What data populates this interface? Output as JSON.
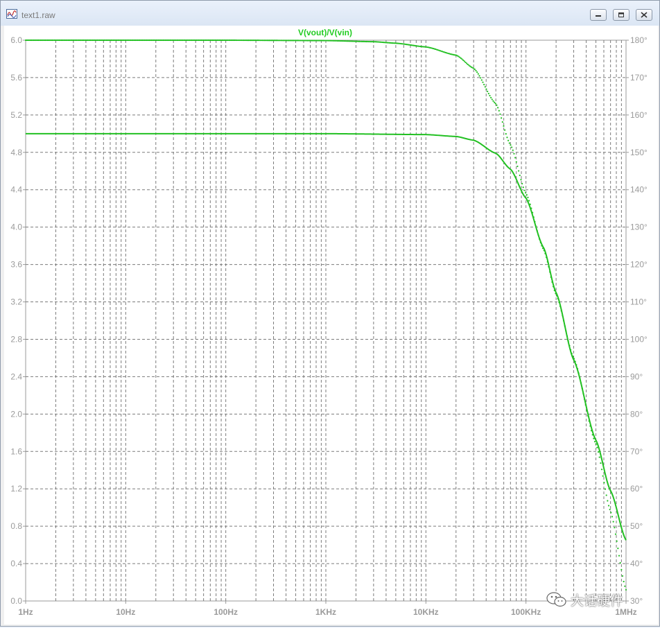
{
  "window": {
    "title": "text1.raw"
  },
  "colors": {
    "trace": "#22c022",
    "grid": "#7a7a7a",
    "tick_text": "#9a9a9a"
  },
  "watermark": {
    "text": "大话硬件",
    "icon": "wechat-icon"
  },
  "chart_data": {
    "type": "line",
    "title": "V(vout)/V(vin)",
    "x_scale": "log",
    "xlim": [
      1,
      1000000
    ],
    "x_ticks": [
      {
        "value": 1,
        "label": "1Hz"
      },
      {
        "value": 10,
        "label": "10Hz"
      },
      {
        "value": 100,
        "label": "100Hz"
      },
      {
        "value": 1000,
        "label": "1KHz"
      },
      {
        "value": 10000,
        "label": "10KHz"
      },
      {
        "value": 100000,
        "label": "100KHz"
      },
      {
        "value": 1000000,
        "label": "1MHz"
      }
    ],
    "ylim_left": [
      0,
      6
    ],
    "y_ticks_left": [
      "0.0",
      "0.4",
      "0.8",
      "1.2",
      "1.6",
      "2.0",
      "2.4",
      "2.8",
      "3.2",
      "3.6",
      "4.0",
      "4.4",
      "4.8",
      "5.2",
      "5.6",
      "6.0"
    ],
    "ylim_right": [
      30,
      180
    ],
    "y_ticks_right": [
      "30°",
      "40°",
      "50°",
      "60°",
      "70°",
      "80°",
      "90°",
      "100°",
      "110°",
      "120°",
      "130°",
      "140°",
      "150°",
      "160°",
      "170°",
      "180°"
    ],
    "grid": true,
    "series": [
      {
        "axis": "left",
        "style": "solid",
        "x": [
          1,
          10,
          100,
          1000,
          10000,
          20000,
          30000,
          50000,
          70000,
          100000,
          150000,
          200000,
          300000,
          500000,
          700000,
          1000000
        ],
        "y": [
          5.0,
          5.0,
          5.0,
          5.0,
          4.99,
          4.97,
          4.93,
          4.79,
          4.62,
          4.31,
          3.78,
          3.3,
          2.58,
          1.72,
          1.18,
          0.65
        ]
      },
      {
        "axis": "right",
        "style": "dotted",
        "x": [
          1,
          10,
          100,
          1000,
          3000,
          5000,
          10000,
          20000,
          30000,
          50000,
          70000,
          100000,
          150000,
          200000,
          300000,
          500000,
          700000,
          1000000
        ],
        "y": [
          180,
          180,
          180,
          179.9,
          179.6,
          179.2,
          178.2,
          176,
          172.5,
          163,
          152,
          139,
          124,
          112,
          95,
          72,
          54,
          33
        ]
      }
    ]
  }
}
